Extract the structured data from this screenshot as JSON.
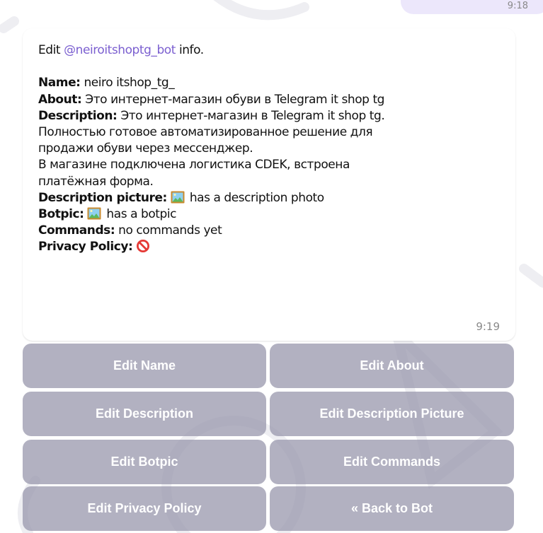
{
  "previous_message": {
    "time": "9:18"
  },
  "message": {
    "intro_prefix": "Edit ",
    "mention": "@neiroitshoptg_bot",
    "intro_suffix": " info.",
    "fields": {
      "name_label": "Name:",
      "name_value": " neiro itshop_tg_",
      "about_label": "About:",
      "about_value": " Это интернет-магазин обуви в Telegram it shop tg",
      "description_label": "Description:",
      "description_line1": " Это интернет-магазин в Telegram it shop tg.",
      "description_line2": "Полностью готовое автоматизированное решение для",
      "description_line3": "продажи обуви через мессенджер.",
      "description_line4": "В магазине подключена логистика CDEK, встроена",
      "description_line5": "платёжная форма.",
      "description_picture_label": "Description picture:",
      "description_picture_value": " has a description photo",
      "botpic_label": "Botpic:",
      "botpic_value": " has a botpic",
      "commands_label": "Commands:",
      "commands_value": " no commands yet",
      "privacy_label": "Privacy Policy:"
    },
    "icons": {
      "picture": "framed-picture-icon",
      "privacy": "prohibited-icon"
    },
    "time": "9:19"
  },
  "keyboard": {
    "buttons": [
      "Edit Name",
      "Edit About",
      "Edit Description",
      "Edit Description Picture",
      "Edit Botpic",
      "Edit Commands",
      "Edit Privacy Policy",
      "« Back to Bot"
    ]
  },
  "colors": {
    "mention": "#7b5fd0",
    "button_bg": "#9c9bb0",
    "button_text": "#ffffff",
    "outgoing_bubble": "#ece7fb",
    "prohibited_red": "#e53935"
  }
}
